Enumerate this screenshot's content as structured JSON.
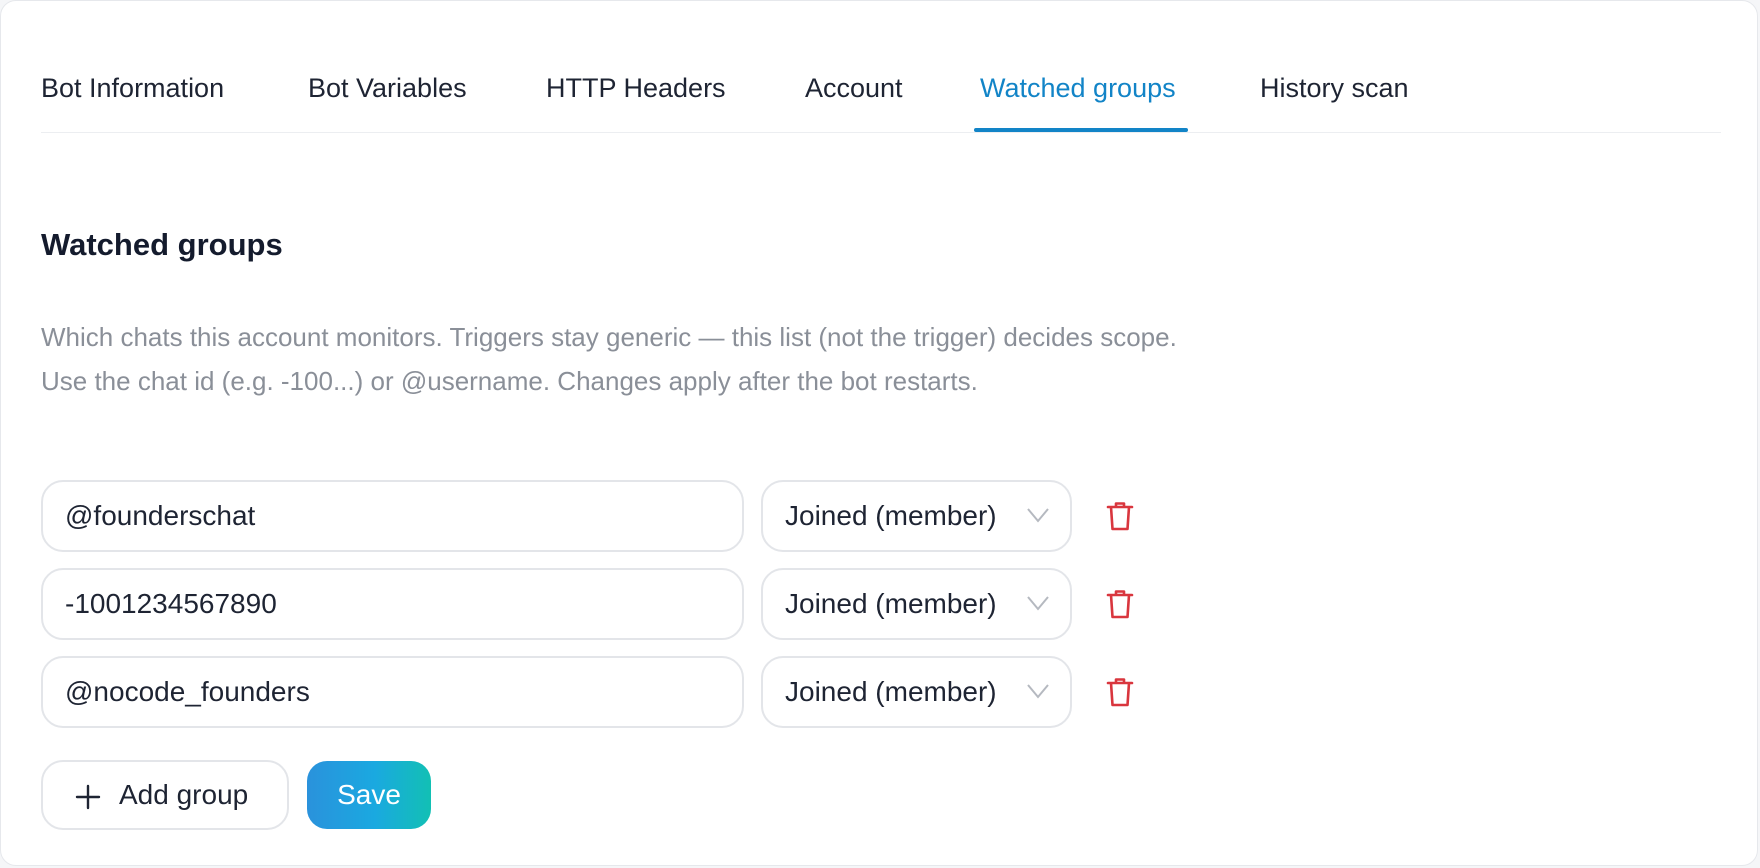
{
  "tabs": [
    {
      "label": "Bot Information"
    },
    {
      "label": "Bot Variables"
    },
    {
      "label": "HTTP Headers"
    },
    {
      "label": "Account"
    },
    {
      "label": "Watched groups",
      "active": true
    },
    {
      "label": "History scan"
    }
  ],
  "section": {
    "title": "Watched groups",
    "description": "Which chats this account monitors. Triggers stay generic — this list (not the trigger) decides scope. Use the chat id (e.g. -100...) or @username. Changes apply after the bot restarts."
  },
  "groups": [
    {
      "value": "@founderschat",
      "mode": "Joined (member)"
    },
    {
      "value": "-1001234567890",
      "mode": "Joined (member)"
    },
    {
      "value": "@nocode_founders",
      "mode": "Joined (member)"
    }
  ],
  "actions": {
    "add_label": "Add group",
    "save_label": "Save"
  },
  "colors": {
    "accent": "#1284c7",
    "delete": "#d9363e",
    "save_gradient_start": "#2a92dc",
    "save_gradient_end": "#12c0b4"
  },
  "icons": [
    "chevron-down-icon",
    "trash-icon",
    "plus-icon"
  ]
}
